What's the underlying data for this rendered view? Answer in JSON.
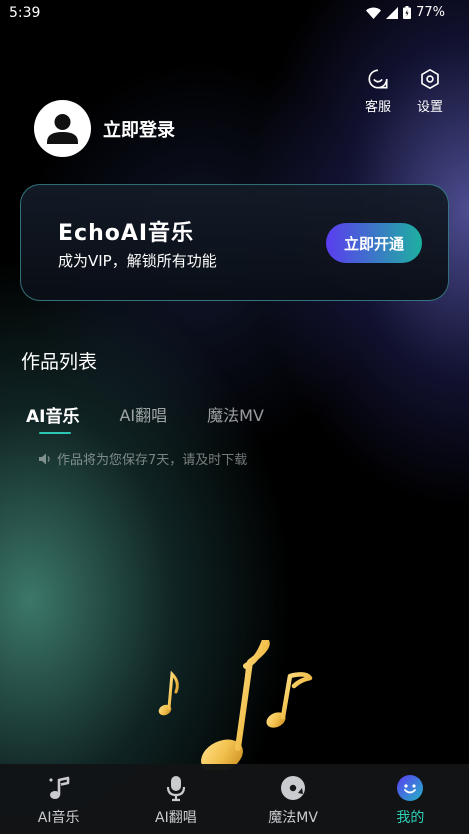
{
  "status_bar": {
    "time": "5:39",
    "battery": "77%"
  },
  "header": {
    "service_label": "客服",
    "settings_label": "设置"
  },
  "user": {
    "login_label": "立即登录"
  },
  "vip_card": {
    "title": "EchoAI音乐",
    "subtitle": "成为VIP，解锁所有功能",
    "button_label": "立即开通"
  },
  "works": {
    "title": "作品列表",
    "tabs": [
      {
        "label": "AI音乐",
        "active": true
      },
      {
        "label": "AI翻唱",
        "active": false
      },
      {
        "label": "魔法MV",
        "active": false
      }
    ],
    "notice": "作品将为您保存7天，请及时下载"
  },
  "bottom_nav": {
    "items": [
      {
        "label": "AI音乐",
        "icon": "music-note-icon",
        "active": false
      },
      {
        "label": "AI翻唱",
        "icon": "microphone-icon",
        "active": false
      },
      {
        "label": "魔法MV",
        "icon": "disc-icon",
        "active": false
      },
      {
        "label": "我的",
        "icon": "profile-face-icon",
        "active": true
      }
    ]
  },
  "colors": {
    "accent": "#2fd0b8",
    "vip_button_start": "#5b3df0",
    "vip_button_end": "#1db0a0",
    "note_gold": "#f2c14e"
  }
}
